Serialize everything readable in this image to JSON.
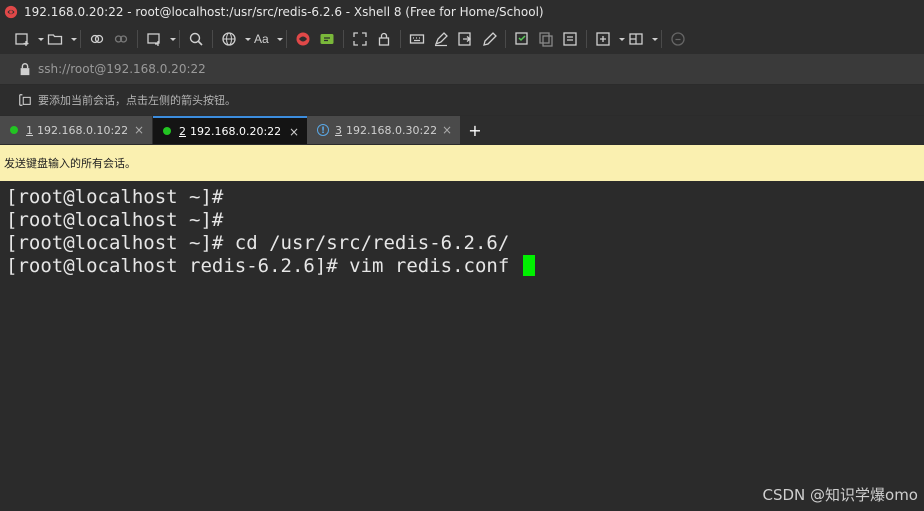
{
  "window": {
    "title": "192.168.0.20:22 - root@localhost:/usr/src/redis-6.2.6 - Xshell 8 (Free for Home/School)",
    "logo_icon": "xshell-logo-icon",
    "accent": "#e04848"
  },
  "toolbar": {
    "buttons": [
      "new-session-icon",
      "open-folder-icon",
      "reconnect-icon",
      "disconnect-icon",
      "transfer-icon",
      "search-icon",
      "globe-icon",
      "font-icon",
      "xshell-icon",
      "xftp-icon",
      "fullscreen-icon",
      "lock-icon",
      "keyboard-icon",
      "highlight-icon",
      "script-icon",
      "compose-icon",
      "new-tab-icon",
      "copy-icon",
      "paste-icon",
      "layout-icon",
      "help-icon"
    ],
    "font_label": "Aa"
  },
  "address": {
    "text": "ssh://root@192.168.0.20:22"
  },
  "hint": {
    "text": "要添加当前会话，点击左侧的箭头按钮。"
  },
  "tabs": [
    {
      "index": "1",
      "label": "192.168.0.10:22",
      "status": "connected",
      "active": false
    },
    {
      "index": "2",
      "label": "192.168.0.20:22",
      "status": "connected",
      "active": true
    },
    {
      "index": "3",
      "label": "192.168.0.30:22",
      "status": "warning",
      "active": false
    }
  ],
  "tab_close_glyph": "×",
  "new_tab_glyph": "+",
  "banner": {
    "text": "发送键盘输入的所有会话。"
  },
  "terminal": {
    "lines": [
      "[root@localhost ~]#",
      "[root@localhost ~]#",
      "[root@localhost ~]# cd /usr/src/redis-6.2.6/",
      "[root@localhost redis-6.2.6]# vim redis.conf "
    ],
    "cursor_color": "#00f000"
  },
  "watermark": {
    "text": "CSDN @知识学爆omo"
  }
}
